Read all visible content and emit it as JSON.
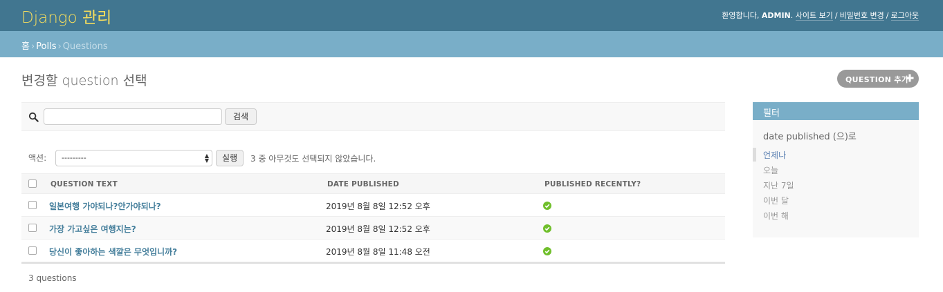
{
  "header": {
    "brand": "Django 관리",
    "welcome": "환영합니다,",
    "user": "ADMIN",
    "links": [
      "사이트 보기",
      "비밀번호 변경",
      "로그아웃"
    ]
  },
  "breadcrumbs": {
    "home": "홈",
    "app": "Polls",
    "current": "Questions"
  },
  "page": {
    "title": "변경할 question 선택",
    "add_button": "QUESTION 추가"
  },
  "search": {
    "value": "",
    "button": "검색",
    "icon": "search-icon"
  },
  "actions": {
    "label": "액션:",
    "selected": "---------",
    "run": "실행",
    "note": "3 중 아무것도 선택되지 않았습니다."
  },
  "table": {
    "columns": [
      "QUESTION TEXT",
      "DATE PUBLISHED",
      "PUBLISHED RECENTLY?"
    ],
    "rows": [
      {
        "question": "일본여행 가야되나?안가야되나?",
        "date": "2019년 8월 8일 12:52 오후",
        "recent": "yes"
      },
      {
        "question": "가장 가고싶은 여행지는?",
        "date": "2019년 8월 8일 12:52 오후",
        "recent": "yes"
      },
      {
        "question": "당신이 좋아하는 색깔은 무엇입니까?",
        "date": "2019년 8월 8일 11:48 오전",
        "recent": "yes"
      }
    ]
  },
  "paginator": "3 questions",
  "filter": {
    "title": "필터",
    "subtitle": "date published (으)로",
    "items": [
      "언제나",
      "오늘",
      "지난 7일",
      "이번 달",
      "이번 해"
    ],
    "selected_index": 0
  },
  "colors": {
    "header_bg": "#417690",
    "breadcrumb_bg": "#79aec8",
    "brand": "#f5dd5d",
    "link": "#447e9b",
    "success": "#70bf2b"
  }
}
